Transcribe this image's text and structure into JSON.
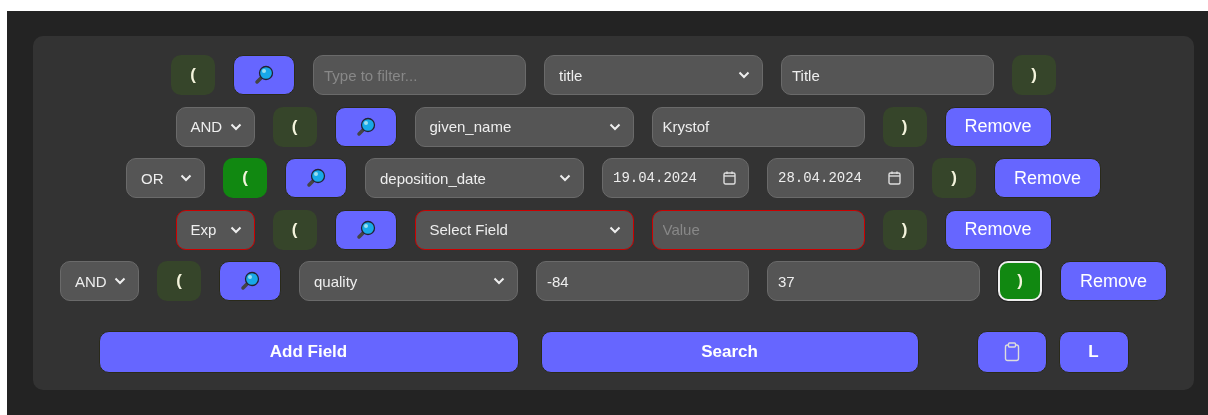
{
  "rows": [
    {
      "items": [
        {
          "kind": "open_paren",
          "text": "(",
          "selected": false,
          "focused": false
        },
        {
          "kind": "search"
        },
        {
          "kind": "filter",
          "placeholder": "Type to filter..."
        },
        {
          "kind": "field",
          "text": "title",
          "invalid": false
        },
        {
          "kind": "value",
          "text": "Title",
          "invalid": false
        },
        {
          "kind": "close_paren",
          "text": ")",
          "selected": false,
          "focused": false
        }
      ]
    },
    {
      "items": [
        {
          "kind": "connector",
          "text": "AND",
          "invalid": false
        },
        {
          "kind": "open_paren",
          "text": "(",
          "selected": false,
          "focused": false
        },
        {
          "kind": "search"
        },
        {
          "kind": "field",
          "text": "given_name",
          "invalid": false
        },
        {
          "kind": "value",
          "text": "Krystof",
          "invalid": false
        },
        {
          "kind": "close_paren",
          "text": ")",
          "selected": false,
          "focused": false
        },
        {
          "kind": "remove",
          "text": "Remove"
        }
      ]
    },
    {
      "items": [
        {
          "kind": "connector",
          "text": "OR",
          "invalid": false
        },
        {
          "kind": "open_paren",
          "text": "(",
          "selected": true,
          "focused": false
        },
        {
          "kind": "search"
        },
        {
          "kind": "field",
          "text": "deposition_date",
          "invalid": false
        },
        {
          "kind": "date",
          "text": "19.04.2024"
        },
        {
          "kind": "date",
          "text": "28.04.2024"
        },
        {
          "kind": "close_paren",
          "text": ")",
          "selected": false,
          "focused": false
        },
        {
          "kind": "remove",
          "text": "Remove"
        }
      ]
    },
    {
      "items": [
        {
          "kind": "connector",
          "text": "Exp",
          "invalid": true
        },
        {
          "kind": "open_paren",
          "text": "(",
          "selected": false,
          "focused": false
        },
        {
          "kind": "search"
        },
        {
          "kind": "field",
          "text": "Select Field",
          "invalid": true
        },
        {
          "kind": "value",
          "placeholder": "Value",
          "invalid": true
        },
        {
          "kind": "close_paren",
          "text": ")",
          "selected": false,
          "focused": false
        },
        {
          "kind": "remove",
          "text": "Remove"
        }
      ]
    },
    {
      "items": [
        {
          "kind": "connector",
          "text": "AND",
          "invalid": false
        },
        {
          "kind": "open_paren",
          "text": "(",
          "selected": false,
          "focused": false
        },
        {
          "kind": "search"
        },
        {
          "kind": "field",
          "text": "quality",
          "invalid": false
        },
        {
          "kind": "value",
          "text": "-84",
          "invalid": false
        },
        {
          "kind": "value",
          "text": "37",
          "invalid": false
        },
        {
          "kind": "close_paren",
          "text": ")",
          "selected": true,
          "focused": true
        },
        {
          "kind": "remove",
          "text": "Remove"
        }
      ]
    }
  ],
  "actions": [
    {
      "kind": "add",
      "text": "Add Field"
    },
    {
      "kind": "search",
      "text": "Search"
    },
    {
      "kind": "clipboard"
    },
    {
      "kind": "letter",
      "text": "L"
    }
  ]
}
